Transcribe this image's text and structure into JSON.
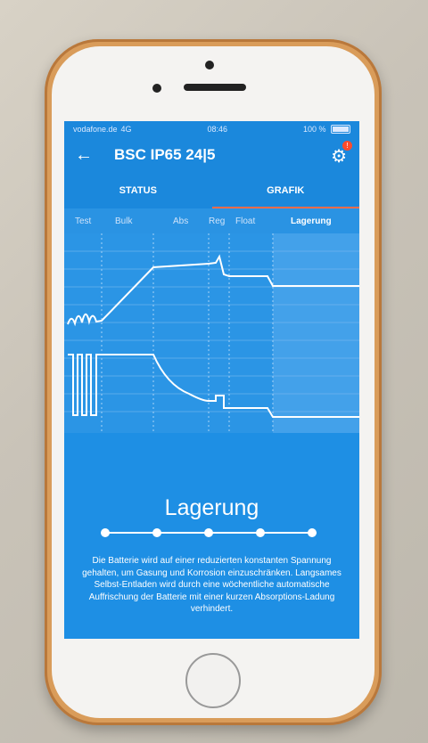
{
  "statusbar": {
    "carrier": "vodafone.de",
    "network": "4G",
    "time": "08:46",
    "battery": "100 %"
  },
  "appbar": {
    "title": "BSC IP65 24|5",
    "back_icon": "back-arrow-icon",
    "gear_icon": "gear-icon",
    "badge": "!"
  },
  "tabs": {
    "status": "STATUS",
    "grafik": "GRAFIK",
    "active": "GRAFIK"
  },
  "stages": [
    "Test",
    "Bulk",
    "Abs",
    "Reg",
    "Float",
    "Lagerung"
  ],
  "active_stage": "Lagerung",
  "info": {
    "title": "Lagerung",
    "text": "Die Batterie wird auf einer reduzierten konstanten Spannung gehalten, um Gasung und Korrosion einzuschränken. Langsames Selbst-Entladen wird durch eine wöchentliche automatische Auffrischung der Batterie mit einer kurzen Absorptions-Ladung verhindert."
  },
  "colors": {
    "screen_bg": "#1e8fe4",
    "accent_tab": "#ff6c4a",
    "phone_frame": "#d99c5a"
  }
}
